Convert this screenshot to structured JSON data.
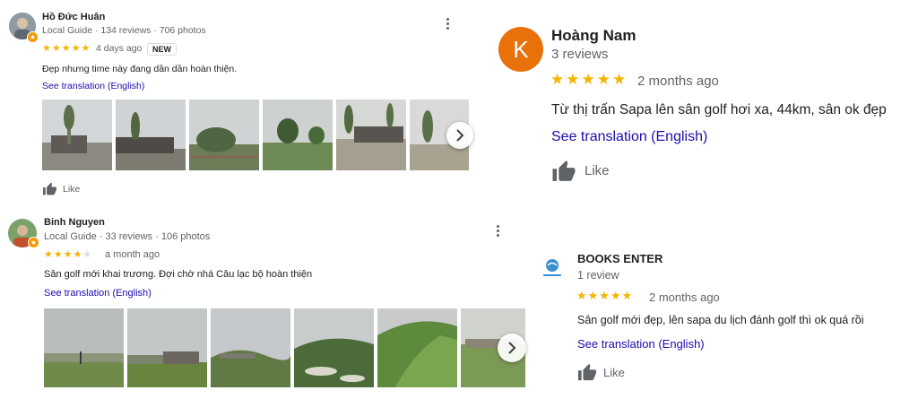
{
  "reviews": [
    {
      "author": "Hồ Đức Huân",
      "meta": "Local Guide · 134 reviews · 706 photos",
      "rating": 5,
      "age": "4 days ago",
      "new_badge": "NEW",
      "text": "Đẹp nhưng time này đang dần dần hoàn thiện.",
      "translate": "See translation (English)",
      "like": "Like"
    },
    {
      "author": "Binh Nguyen",
      "meta": "Local Guide · 33 reviews · 106 photos",
      "rating": 4,
      "age": "a month ago",
      "text": "Sân golf mới khai trương. Đợi chờ nhá Câu lạc bộ hoàn thiện",
      "translate": "See translation (English)",
      "like": "Like"
    },
    {
      "author": "Hoàng Nam",
      "avatar_letter": "K",
      "meta": "3 reviews",
      "rating": 5,
      "age": "2 months ago",
      "text": "Từ thị trấn Sapa lên sân golf hơi xa, 44km, sân ok đẹp",
      "translate": "See translation (English)",
      "like": "Like"
    },
    {
      "author": "BOOKS ENTER",
      "meta": "1 review",
      "rating": 5,
      "age": "2 months ago",
      "text": "Sân golf mới đẹp, lên sapa du lịch đánh golf thì ok quá rồi",
      "translate": "See translation (English)",
      "like": "Like"
    }
  ],
  "colors": {
    "star": "#f5b400",
    "link": "#1a0dab",
    "avatar_orange": "#e8710a",
    "local_guide_badge": "#f29900"
  },
  "icons": [
    "more-vert-icon",
    "thumb-up-icon",
    "chevron-right-icon",
    "local-guide-icon"
  ]
}
